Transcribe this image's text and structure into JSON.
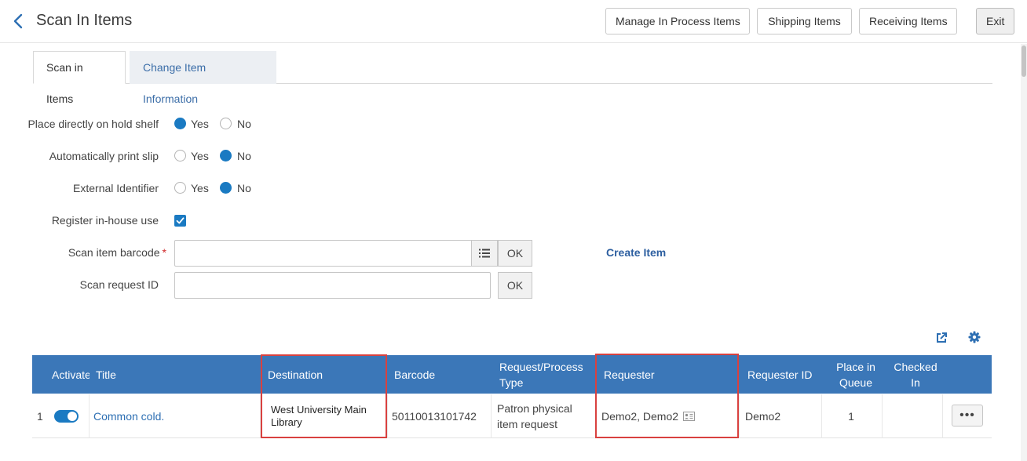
{
  "header": {
    "title": "Scan In Items",
    "buttons": {
      "manage": "Manage In Process Items",
      "shipping": "Shipping Items",
      "receiving": "Receiving Items",
      "exit": "Exit"
    }
  },
  "tabs": {
    "active": "Scan in Items",
    "inactive": "Change Item Information"
  },
  "form": {
    "hold_shelf": {
      "label": "Place directly on hold shelf",
      "yes": "Yes",
      "no": "No",
      "selected": "Yes"
    },
    "print_slip": {
      "label": "Automatically print slip",
      "yes": "Yes",
      "no": "No",
      "selected": "No"
    },
    "external_id": {
      "label": "External Identifier",
      "yes": "Yes",
      "no": "No",
      "selected": "No"
    },
    "in_house": {
      "label": "Register in-house use",
      "checked": true
    },
    "barcode": {
      "label": "Scan item barcode",
      "required_mark": "*",
      "value": "",
      "ok": "OK"
    },
    "request_id": {
      "label": "Scan request ID",
      "value": "",
      "ok": "OK"
    },
    "create_item": "Create Item"
  },
  "table": {
    "columns": {
      "activate": "Activate",
      "title": "Title",
      "destination": "Destination",
      "barcode": "Barcode",
      "request_type": "Request/Process Type",
      "requester": "Requester",
      "requester_id": "Requester ID",
      "place_in_queue": "Place in Queue",
      "checked_in": "Checked In"
    },
    "rows": [
      {
        "num": "1",
        "active": true,
        "title": "Common cold.",
        "destination": "West University Main Library",
        "barcode": "50110013101742",
        "request_type": "Patron physical item request",
        "requester": "Demo2, Demo2",
        "requester_id": "Demo2",
        "place_in_queue": "1",
        "checked_in": "",
        "more": "•••"
      }
    ]
  },
  "colors": {
    "header_blue": "#3b77b8",
    "accent_blue": "#1a7ac2",
    "highlight_red": "#d9413f"
  },
  "icons": [
    "back-icon",
    "list-icon",
    "export-icon",
    "gear-icon",
    "contact-card-icon"
  ]
}
